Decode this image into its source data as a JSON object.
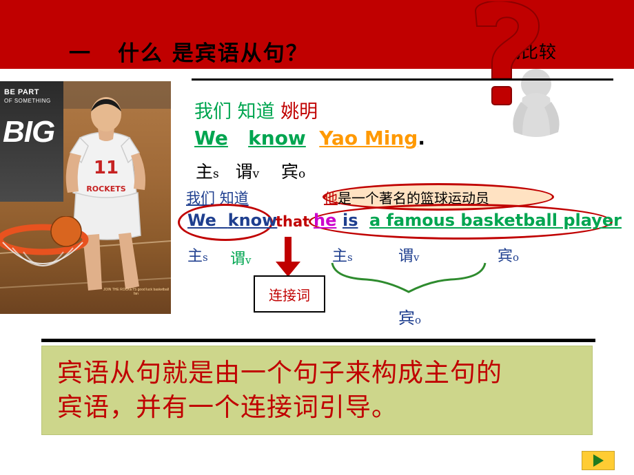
{
  "banner": {
    "title_part1": "一",
    "title_part2": "什么",
    "title_part3": "是宾语从句？",
    "subtitle": "试比较",
    "bg_color": "#c00000",
    "qmark_icon": "question-mark-icon"
  },
  "photo": {
    "alt": "yao-ming-basketball-photo",
    "overlay_line1": "BE PART",
    "overlay_line2": "OF SOMETHING",
    "overlay_big": "BIG",
    "caption": "JOIN THE ROCKETS\ngood luck basketball fan"
  },
  "example": {
    "cn_line1_w1": "我们",
    "cn_line1_w2": "知道",
    "cn_line1_w3": "姚明",
    "en_line1_w1": "We",
    "en_line1_w2": "know",
    "en_line1_w3": "Yao Ming",
    "en_line1_dot": ".",
    "roles_line1_subject": "主",
    "roles_line1_subject_sub": "s",
    "roles_line1_verb": "谓",
    "roles_line1_verb_sub": "v",
    "roles_line1_object": "宾",
    "roles_line1_object_sub": "o",
    "cn_line2_a": "我们",
    "cn_line2_b": "知道",
    "cn_line2_clause_red": "他",
    "cn_line2_clause_black": "是一个著名的篮球运动员",
    "en_line2_we": "We",
    "en_line2_know": "know",
    "en_line2_that": "that",
    "en_line2_he": "he",
    "en_line2_is": "is",
    "en_line2_rest": "a famous basketball player",
    "roles2_zhu": "主",
    "roles2_zhu_sub": "s",
    "roles2_wei": "谓",
    "roles2_wei_sub": "v",
    "roles3_zhu": "主",
    "roles3_zhu_sub": "s",
    "roles3_wei": "谓",
    "roles3_wei_sub": "v",
    "roles3_bin": "宾",
    "roles3_bin_sub": "o",
    "brace_label": "宾",
    "brace_label_sub": "o",
    "connector_box_label": "连接词"
  },
  "conclusion": {
    "line1": "宾语从句就是由一个句子来构成主句的",
    "line2": "宾语，并有一个连接词引导。",
    "bg_color": "#cdd68b",
    "text_color": "#c00000"
  },
  "nav": {
    "next_icon": "play-triangle-icon"
  }
}
